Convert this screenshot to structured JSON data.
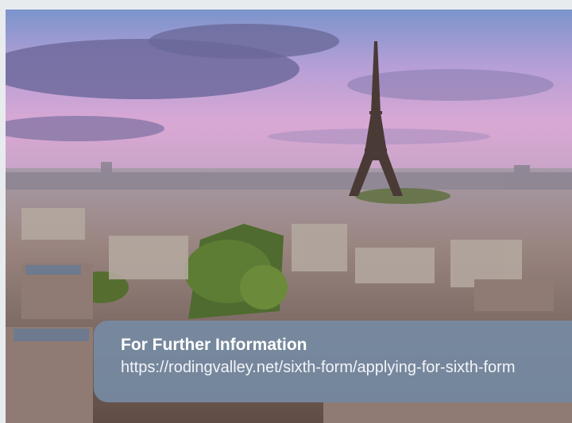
{
  "photo": {
    "subject": "Paris skyline with Eiffel Tower at sunset"
  },
  "info_panel": {
    "title": "For Further Information",
    "link": "https://rodingvalley.net/sixth-form/applying-for-sixth-form"
  }
}
